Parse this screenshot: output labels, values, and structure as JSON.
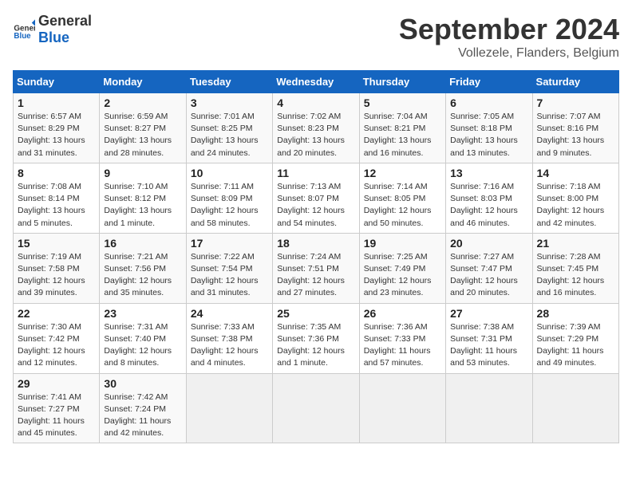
{
  "logo": {
    "general": "General",
    "blue": "Blue"
  },
  "header": {
    "month_year": "September 2024",
    "location": "Vollezele, Flanders, Belgium"
  },
  "weekdays": [
    "Sunday",
    "Monday",
    "Tuesday",
    "Wednesday",
    "Thursday",
    "Friday",
    "Saturday"
  ],
  "weeks": [
    [
      {
        "day": "1",
        "sunrise": "Sunrise: 6:57 AM",
        "sunset": "Sunset: 8:29 PM",
        "daylight": "Daylight: 13 hours and 31 minutes."
      },
      {
        "day": "2",
        "sunrise": "Sunrise: 6:59 AM",
        "sunset": "Sunset: 8:27 PM",
        "daylight": "Daylight: 13 hours and 28 minutes."
      },
      {
        "day": "3",
        "sunrise": "Sunrise: 7:01 AM",
        "sunset": "Sunset: 8:25 PM",
        "daylight": "Daylight: 13 hours and 24 minutes."
      },
      {
        "day": "4",
        "sunrise": "Sunrise: 7:02 AM",
        "sunset": "Sunset: 8:23 PM",
        "daylight": "Daylight: 13 hours and 20 minutes."
      },
      {
        "day": "5",
        "sunrise": "Sunrise: 7:04 AM",
        "sunset": "Sunset: 8:21 PM",
        "daylight": "Daylight: 13 hours and 16 minutes."
      },
      {
        "day": "6",
        "sunrise": "Sunrise: 7:05 AM",
        "sunset": "Sunset: 8:18 PM",
        "daylight": "Daylight: 13 hours and 13 minutes."
      },
      {
        "day": "7",
        "sunrise": "Sunrise: 7:07 AM",
        "sunset": "Sunset: 8:16 PM",
        "daylight": "Daylight: 13 hours and 9 minutes."
      }
    ],
    [
      {
        "day": "8",
        "sunrise": "Sunrise: 7:08 AM",
        "sunset": "Sunset: 8:14 PM",
        "daylight": "Daylight: 13 hours and 5 minutes."
      },
      {
        "day": "9",
        "sunrise": "Sunrise: 7:10 AM",
        "sunset": "Sunset: 8:12 PM",
        "daylight": "Daylight: 13 hours and 1 minute."
      },
      {
        "day": "10",
        "sunrise": "Sunrise: 7:11 AM",
        "sunset": "Sunset: 8:09 PM",
        "daylight": "Daylight: 12 hours and 58 minutes."
      },
      {
        "day": "11",
        "sunrise": "Sunrise: 7:13 AM",
        "sunset": "Sunset: 8:07 PM",
        "daylight": "Daylight: 12 hours and 54 minutes."
      },
      {
        "day": "12",
        "sunrise": "Sunrise: 7:14 AM",
        "sunset": "Sunset: 8:05 PM",
        "daylight": "Daylight: 12 hours and 50 minutes."
      },
      {
        "day": "13",
        "sunrise": "Sunrise: 7:16 AM",
        "sunset": "Sunset: 8:03 PM",
        "daylight": "Daylight: 12 hours and 46 minutes."
      },
      {
        "day": "14",
        "sunrise": "Sunrise: 7:18 AM",
        "sunset": "Sunset: 8:00 PM",
        "daylight": "Daylight: 12 hours and 42 minutes."
      }
    ],
    [
      {
        "day": "15",
        "sunrise": "Sunrise: 7:19 AM",
        "sunset": "Sunset: 7:58 PM",
        "daylight": "Daylight: 12 hours and 39 minutes."
      },
      {
        "day": "16",
        "sunrise": "Sunrise: 7:21 AM",
        "sunset": "Sunset: 7:56 PM",
        "daylight": "Daylight: 12 hours and 35 minutes."
      },
      {
        "day": "17",
        "sunrise": "Sunrise: 7:22 AM",
        "sunset": "Sunset: 7:54 PM",
        "daylight": "Daylight: 12 hours and 31 minutes."
      },
      {
        "day": "18",
        "sunrise": "Sunrise: 7:24 AM",
        "sunset": "Sunset: 7:51 PM",
        "daylight": "Daylight: 12 hours and 27 minutes."
      },
      {
        "day": "19",
        "sunrise": "Sunrise: 7:25 AM",
        "sunset": "Sunset: 7:49 PM",
        "daylight": "Daylight: 12 hours and 23 minutes."
      },
      {
        "day": "20",
        "sunrise": "Sunrise: 7:27 AM",
        "sunset": "Sunset: 7:47 PM",
        "daylight": "Daylight: 12 hours and 20 minutes."
      },
      {
        "day": "21",
        "sunrise": "Sunrise: 7:28 AM",
        "sunset": "Sunset: 7:45 PM",
        "daylight": "Daylight: 12 hours and 16 minutes."
      }
    ],
    [
      {
        "day": "22",
        "sunrise": "Sunrise: 7:30 AM",
        "sunset": "Sunset: 7:42 PM",
        "daylight": "Daylight: 12 hours and 12 minutes."
      },
      {
        "day": "23",
        "sunrise": "Sunrise: 7:31 AM",
        "sunset": "Sunset: 7:40 PM",
        "daylight": "Daylight: 12 hours and 8 minutes."
      },
      {
        "day": "24",
        "sunrise": "Sunrise: 7:33 AM",
        "sunset": "Sunset: 7:38 PM",
        "daylight": "Daylight: 12 hours and 4 minutes."
      },
      {
        "day": "25",
        "sunrise": "Sunrise: 7:35 AM",
        "sunset": "Sunset: 7:36 PM",
        "daylight": "Daylight: 12 hours and 1 minute."
      },
      {
        "day": "26",
        "sunrise": "Sunrise: 7:36 AM",
        "sunset": "Sunset: 7:33 PM",
        "daylight": "Daylight: 11 hours and 57 minutes."
      },
      {
        "day": "27",
        "sunrise": "Sunrise: 7:38 AM",
        "sunset": "Sunset: 7:31 PM",
        "daylight": "Daylight: 11 hours and 53 minutes."
      },
      {
        "day": "28",
        "sunrise": "Sunrise: 7:39 AM",
        "sunset": "Sunset: 7:29 PM",
        "daylight": "Daylight: 11 hours and 49 minutes."
      }
    ],
    [
      {
        "day": "29",
        "sunrise": "Sunrise: 7:41 AM",
        "sunset": "Sunset: 7:27 PM",
        "daylight": "Daylight: 11 hours and 45 minutes."
      },
      {
        "day": "30",
        "sunrise": "Sunrise: 7:42 AM",
        "sunset": "Sunset: 7:24 PM",
        "daylight": "Daylight: 11 hours and 42 minutes."
      },
      null,
      null,
      null,
      null,
      null
    ]
  ]
}
